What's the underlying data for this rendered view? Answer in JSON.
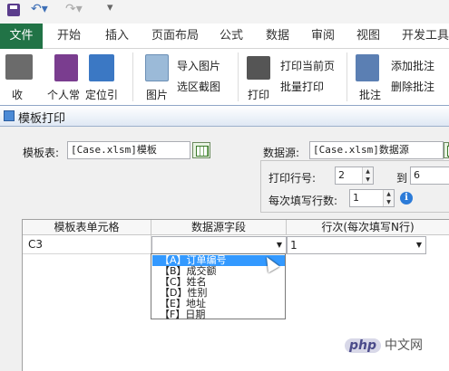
{
  "ribbon_tabs": [
    "文件",
    "开始",
    "插入",
    "页面布局",
    "公式",
    "数据",
    "审阅",
    "视图",
    "开发工具"
  ],
  "ribbon": {
    "btn_shou": "收",
    "btn_personal": "个人常",
    "btn_locate": "定位引",
    "btn_image": "图片",
    "btn_import_image": "导入图片",
    "btn_select_screenshot": "选区截图",
    "btn_print": "打印",
    "btn_print_current": "打印当前页",
    "btn_batch_print": "批量打印",
    "btn_annotate": "批注",
    "btn_add_note": "添加批注",
    "btn_delete_note": "删除批注"
  },
  "dialog": {
    "title": "模板打印",
    "template_label": "模板表:",
    "template_value": "[Case.xlsm]模板",
    "datasource_label": "数据源:",
    "datasource_value": "[Case.xlsm]数据源",
    "print_row_label": "打印行号:",
    "row_from": "2",
    "to_label": "到",
    "row_to": "6",
    "rows_per_fill_label": "每次填写行数:",
    "rows_per_fill": "1",
    "info_icon_text": "i"
  },
  "grid": {
    "headers": [
      "模板表单元格",
      "数据源字段",
      "行次(每次填写N行)"
    ],
    "row": {
      "cell": "C3",
      "field": "",
      "row_no": "1"
    }
  },
  "dropdown": {
    "options": [
      "【A】订单编号",
      "【B】成交额",
      "【C】姓名",
      "【D】性别",
      "【E】地址",
      "【F】日期"
    ],
    "selected_index": 0
  },
  "watermark": {
    "brand": "php",
    "text": "中文网"
  }
}
